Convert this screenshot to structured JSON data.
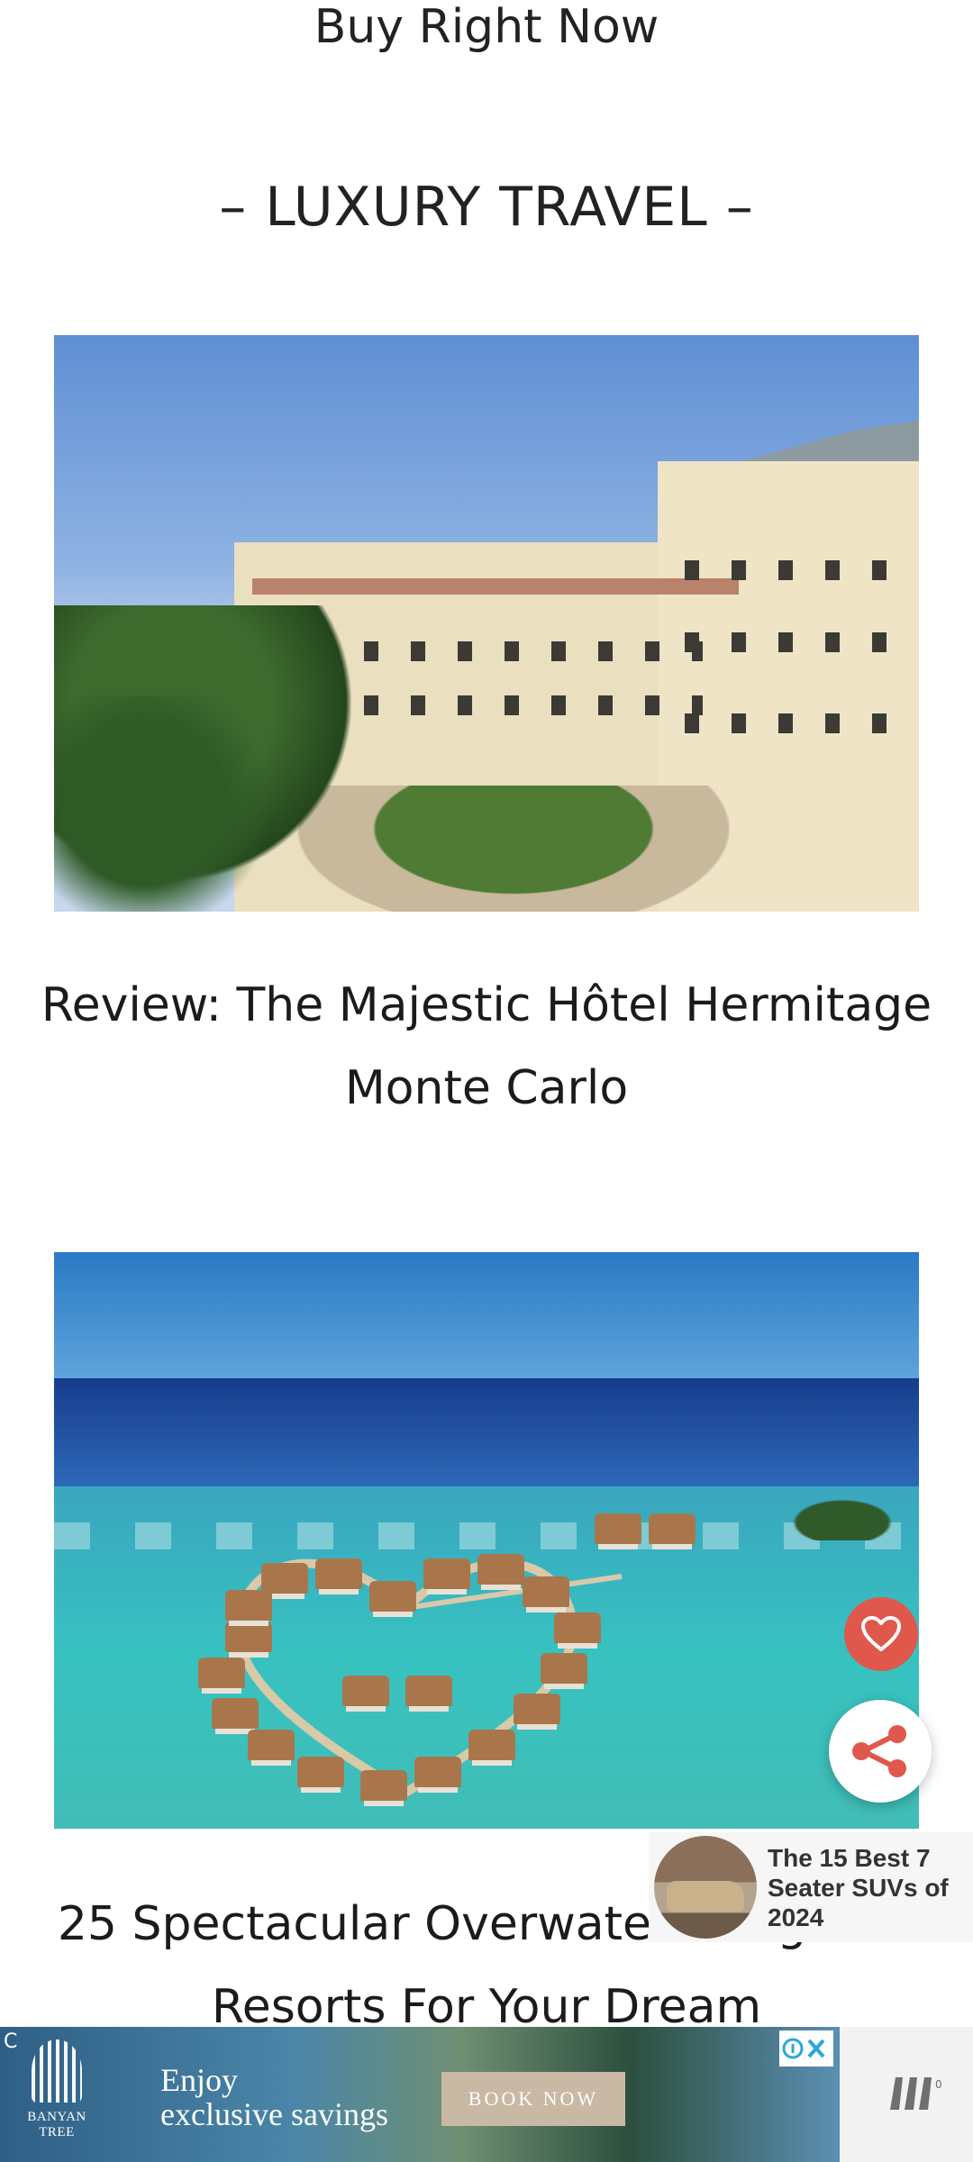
{
  "top_link": "Buy Right Now",
  "section_heading": "– LUXURY TRAVEL –",
  "articles": [
    {
      "title": "Review: The Majestic Hôtel Hermitage Monte Carlo",
      "image_icon": "hotel-photo"
    },
    {
      "title": "25 Spectacular Overwater Bungalow Resorts For Your Dream",
      "image_icon": "overwater-resort-photo"
    }
  ],
  "promo": {
    "text": "The 15 Best 7 Seater SUVs of 2024"
  },
  "ad": {
    "brand": "BANYAN TREE",
    "copy_line1": "Enjoy",
    "copy_line2": "exclusive savings",
    "button": "BOOK NOW"
  },
  "colors": {
    "heart_button": "#e0574c",
    "share_icon": "#e0574c"
  }
}
